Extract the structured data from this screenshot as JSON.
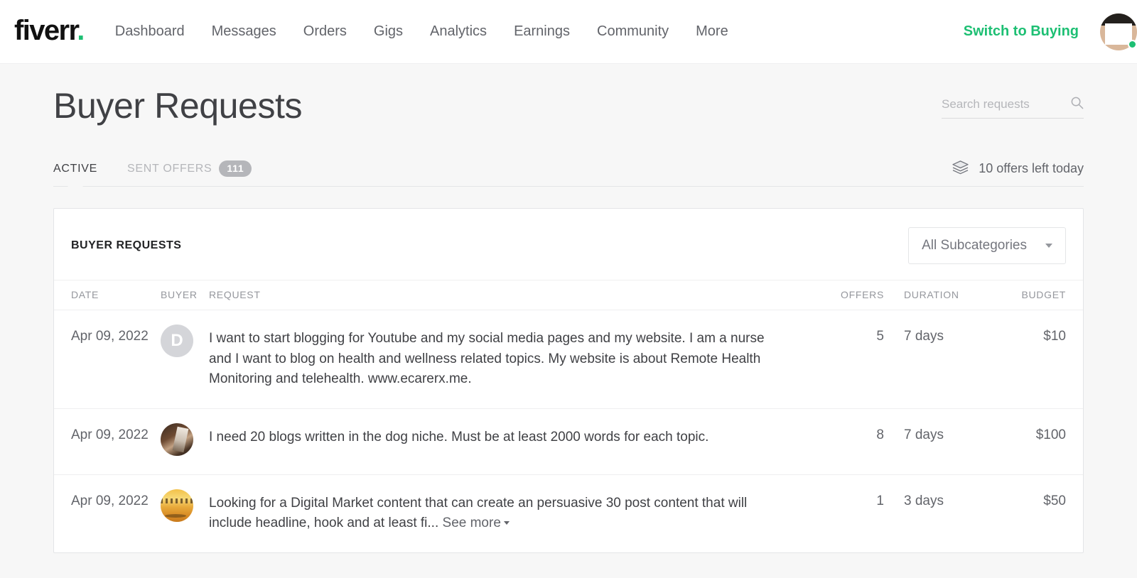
{
  "header": {
    "logo_text": "fiverr",
    "logo_dot": ".",
    "nav": [
      {
        "label": "Dashboard"
      },
      {
        "label": "Messages"
      },
      {
        "label": "Orders"
      },
      {
        "label": "Gigs"
      },
      {
        "label": "Analytics"
      },
      {
        "label": "Earnings"
      },
      {
        "label": "Community"
      },
      {
        "label": "More"
      }
    ],
    "switch_label": "Switch to Buying",
    "accent_color": "#1dbf73",
    "avatar_icon": "user-avatar",
    "status": "online"
  },
  "page": {
    "title": "Buyer Requests"
  },
  "search": {
    "placeholder": "Search requests",
    "value": "",
    "icon": "search-icon"
  },
  "tabs": [
    {
      "label": "ACTIVE",
      "active": true,
      "badge": null
    },
    {
      "label": "SENT OFFERS",
      "active": false,
      "badge": "111"
    }
  ],
  "offers_left": {
    "icon": "layers-icon",
    "text": "10 offers left today"
  },
  "card": {
    "title": "BUYER REQUESTS",
    "subcategory_select": {
      "value": "All Subcategories",
      "caret_icon": "chevron-down-icon"
    }
  },
  "table": {
    "columns": [
      "DATE",
      "BUYER",
      "REQUEST",
      "OFFERS",
      "DURATION",
      "BUDGET"
    ],
    "rows": [
      {
        "date": "Apr 09, 2022",
        "avatar_type": "letter",
        "avatar_letter": "D",
        "request": "I want to start blogging for Youtube and my social media pages and my website. I am a nurse and I want to blog on health and wellness related topics. My website is about Remote Health Monitoring and telehealth. www.ecarerx.me.",
        "truncated": false,
        "see_more": "",
        "offers": "5",
        "duration": "7 days",
        "budget": "$10"
      },
      {
        "date": "Apr 09, 2022",
        "avatar_type": "photo-dog",
        "avatar_letter": "",
        "request": "I need 20 blogs written in the dog niche. Must be at least 2000 words for each topic.",
        "truncated": false,
        "see_more": "",
        "offers": "8",
        "duration": "7 days",
        "budget": "$100"
      },
      {
        "date": "Apr 09, 2022",
        "avatar_type": "photo-sunset",
        "avatar_letter": "",
        "request": "Looking for a Digital Market content that can create an persuasive 30 post content that will include headline, hook and at least fi...",
        "truncated": true,
        "see_more": "See more",
        "offers": "1",
        "duration": "3 days",
        "budget": "$50"
      }
    ]
  }
}
